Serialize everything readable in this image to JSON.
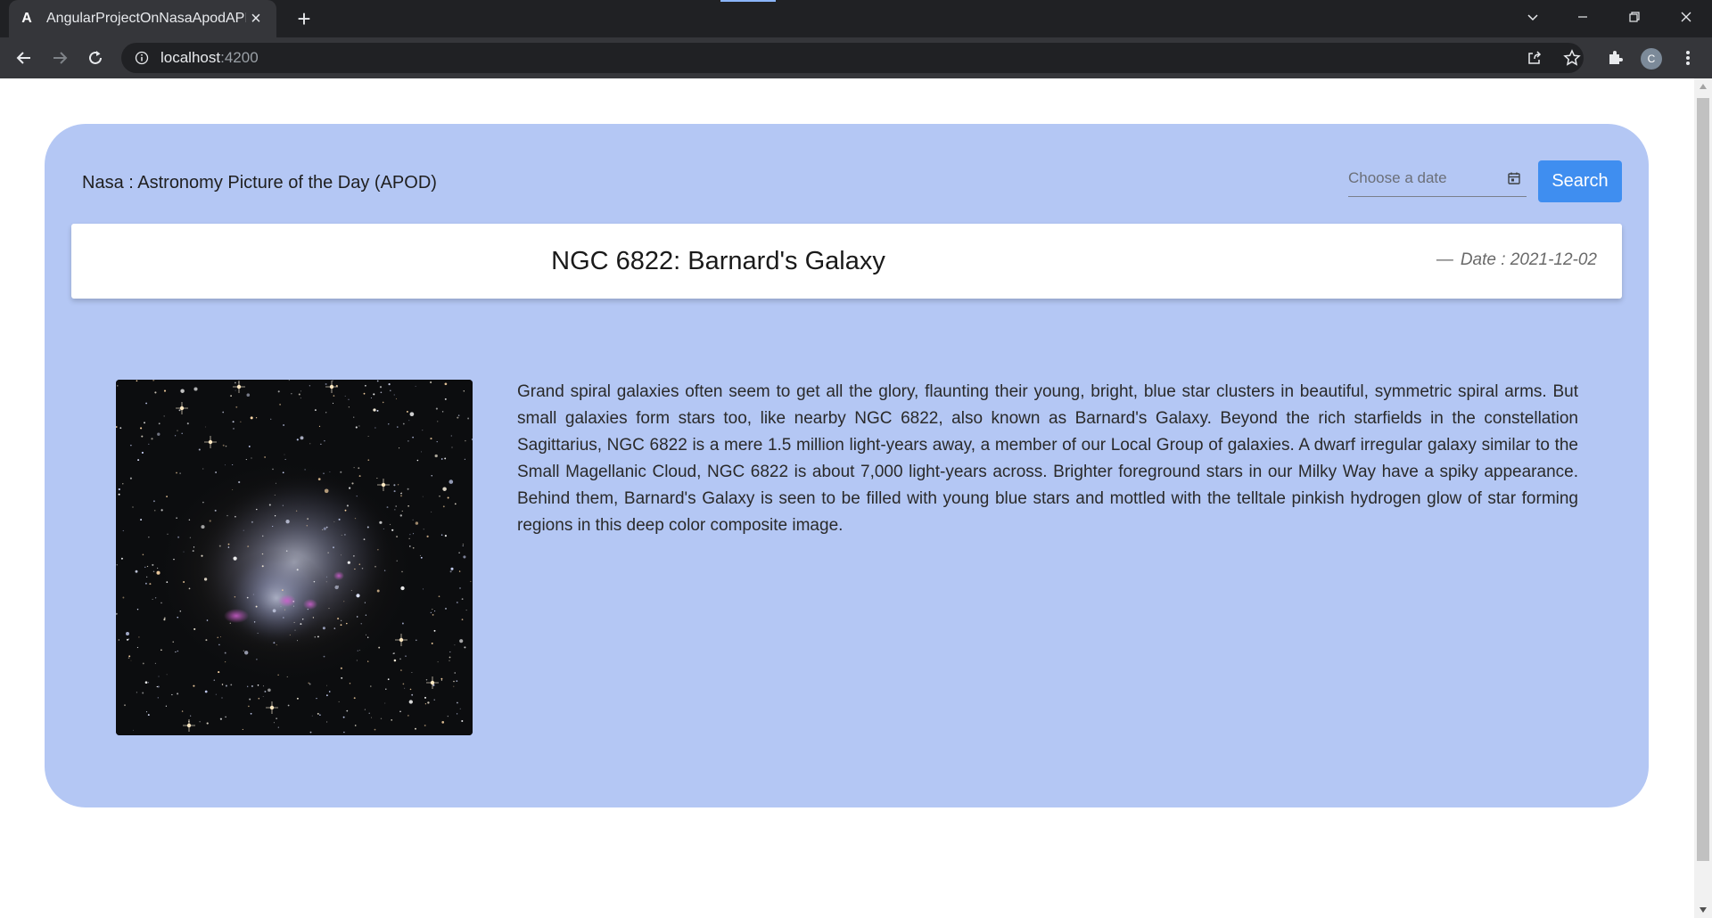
{
  "browser": {
    "tab_title": "AngularProjectOnNasaApodAPI",
    "favicon_letter": "A",
    "url_host": "localhost",
    "url_port": ":4200",
    "profile_initial": "C"
  },
  "app": {
    "title": "Nasa : Astronomy Picture of the Day (APOD)",
    "date_placeholder": "Choose a date",
    "search_label": "Search"
  },
  "apod": {
    "title": "NGC 6822: Barnard's Galaxy",
    "date_text": "Date : 2021-12-02",
    "date_dash": "—",
    "explanation": "Grand spiral galaxies often seem to get all the glory, flaunting their young, bright, blue star clusters in beautiful, symmetric spiral arms. But small galaxies form stars too, like nearby NGC 6822, also known as Barnard's Galaxy. Beyond the rich starfields in the constellation Sagittarius, NGC 6822 is a mere 1.5 million light-years away, a member of our Local Group of galaxies. A dwarf irregular galaxy similar to the Small Magellanic Cloud, NGC 6822 is about 7,000 light-years across. Brighter foreground stars in our Milky Way have a spiky appearance. Behind them, Barnard's Galaxy is seen to be filled with young blue stars and mottled with the telltale pinkish hydrogen glow of star forming regions in this deep color composite image."
  },
  "colors": {
    "page_background": "#ffffff",
    "card_background": "#b4c7f4",
    "button_blue": "#3f8ef0",
    "chrome_dark": "#202124",
    "chrome_toolbar": "#35363a"
  }
}
